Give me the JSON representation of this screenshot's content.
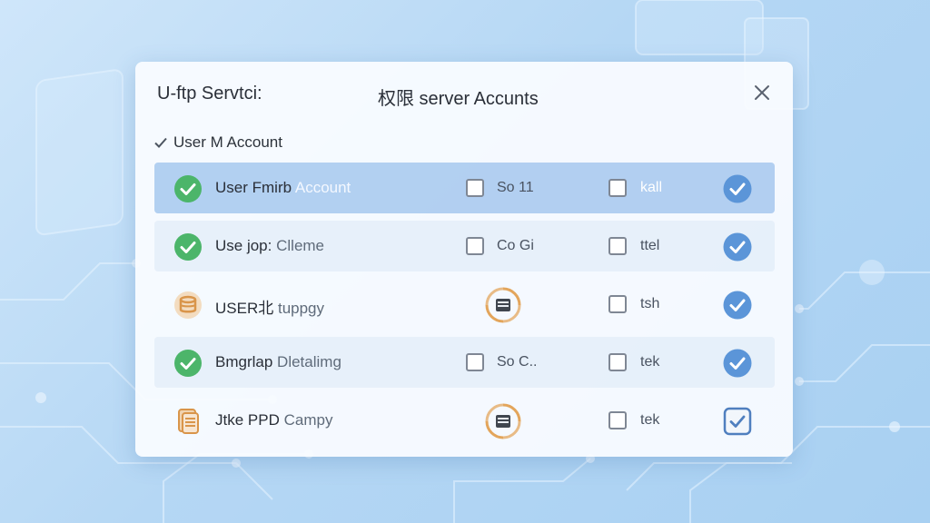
{
  "dialog": {
    "title_left": "U-ftp Servtci:",
    "title_center": "权限 server Accunts",
    "section_label": "User M Account"
  },
  "rows": [
    {
      "name": "User Fmirb",
      "name_soft": "Account",
      "col2": "So 11",
      "col3": "kall",
      "state": "selected"
    },
    {
      "name": "Use jop:",
      "name_soft": "Clleme",
      "col2": "Co Gi",
      "col3": "ttel",
      "state": "alt"
    },
    {
      "name": "USER北",
      "name_soft": "tuppgy",
      "col2": "",
      "col3": "tsh",
      "state": "normal"
    },
    {
      "name": "Bmgrlap",
      "name_soft": "Dletalimg",
      "col2": "So C..",
      "col3": "tek",
      "state": "alt"
    },
    {
      "name": "Jtke PPD",
      "name_soft": "Campy",
      "col2": "",
      "col3": "tek",
      "state": "normal"
    }
  ],
  "colors": {
    "accent": "#5b95d8",
    "success": "#4cb56a",
    "warning": "#e3a55b",
    "selected_row": "#a6c8ee"
  },
  "icons": {
    "close": "close-icon",
    "section": "checkmark-icon",
    "status_ok": "check-circle-icon",
    "status_warn": "database-warning-icon",
    "status_file": "document-stack-icon",
    "column_ring": "server-sync-icon",
    "row_end": "check-badge-icon"
  }
}
